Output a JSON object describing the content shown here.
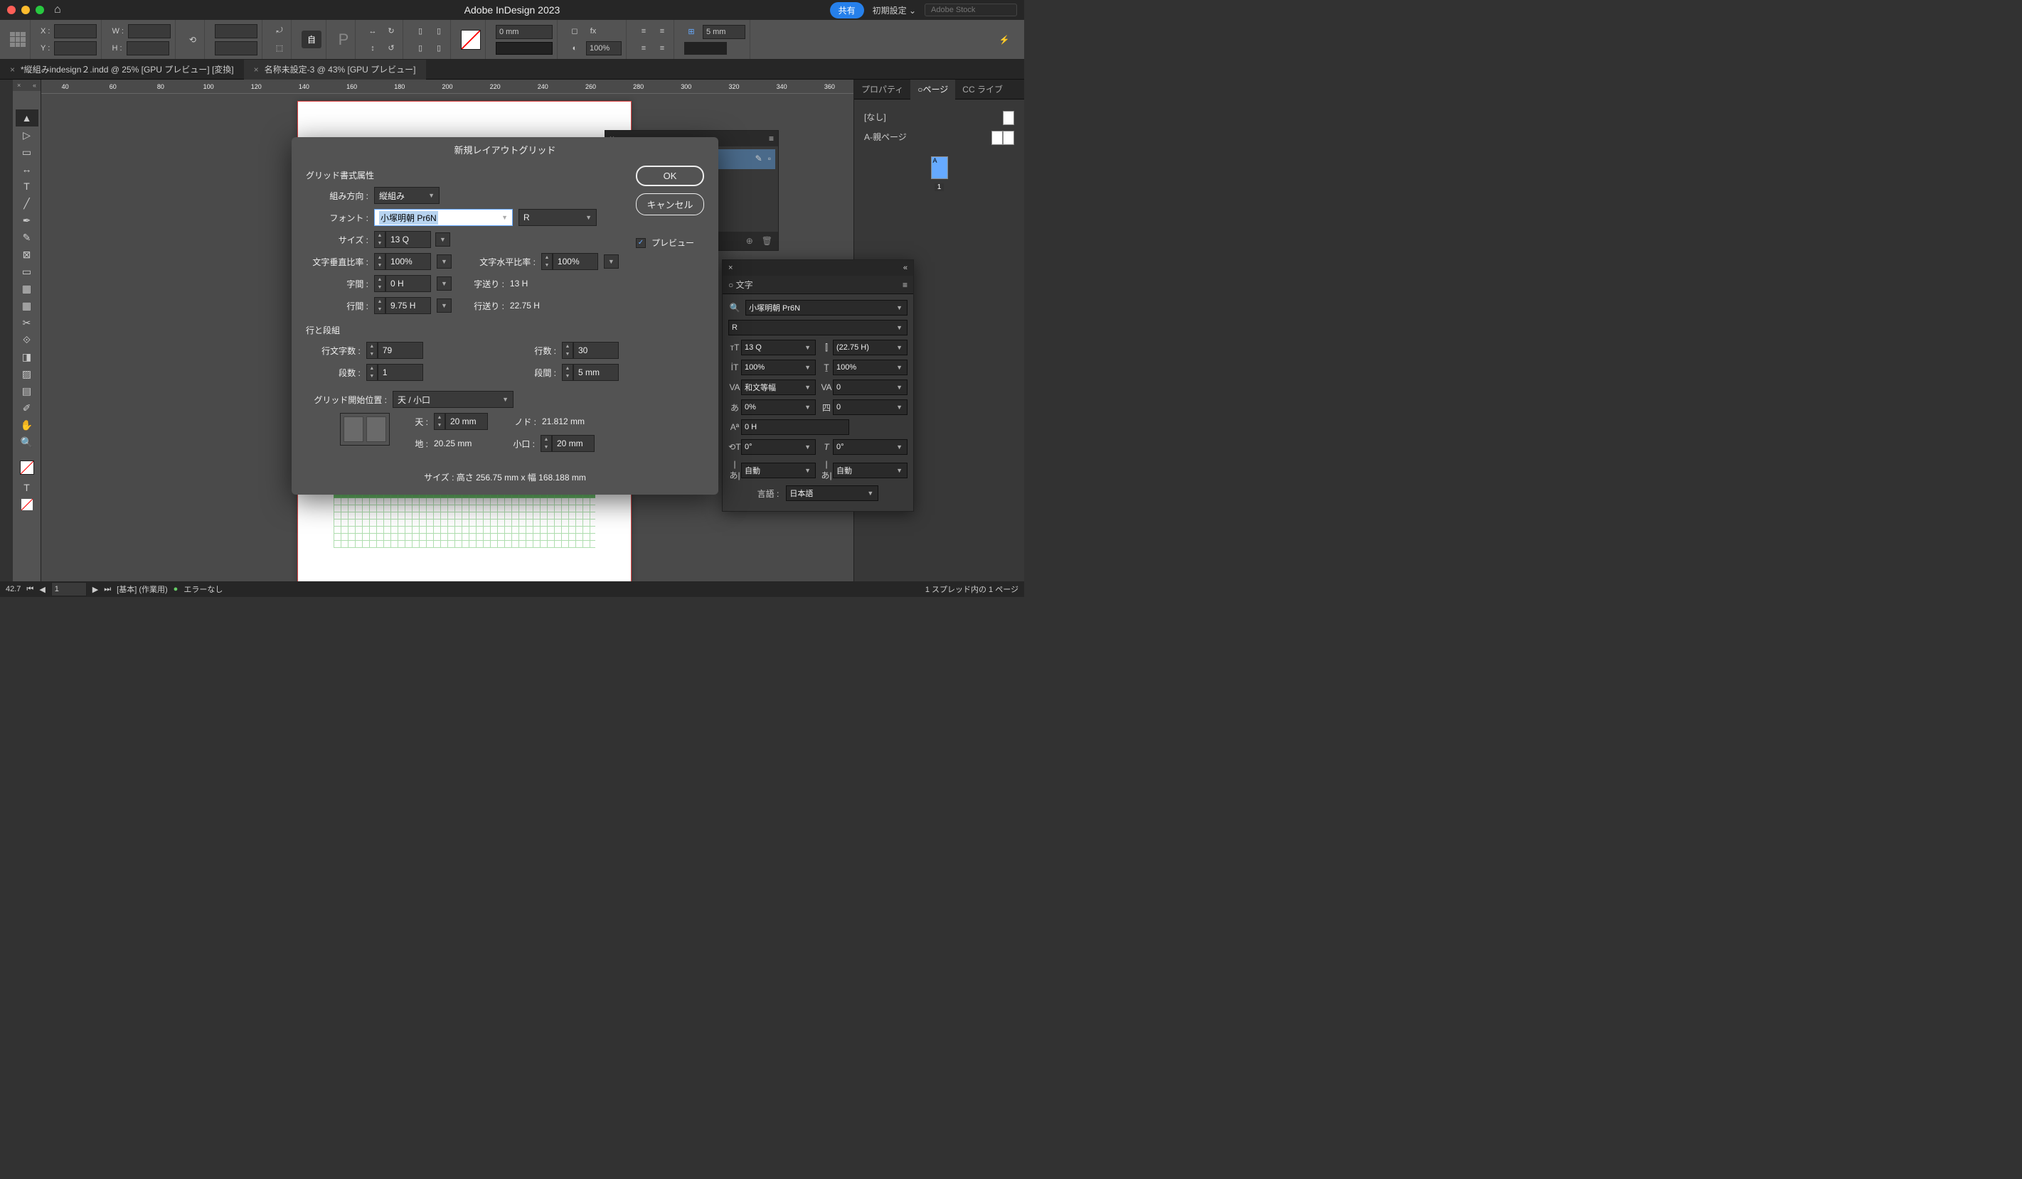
{
  "app": {
    "title": "Adobe InDesign 2023",
    "share": "共有",
    "preset": "初期設定",
    "stock_placeholder": "Adobe Stock"
  },
  "tabs": [
    {
      "label": "*縦組みindesign２.indd @ 25% [GPU プレビュー] [変換]"
    },
    {
      "label": "名称未設定-3 @ 43% [GPU プレビュー]"
    }
  ],
  "controlbar": {
    "x": "X :",
    "y": "Y :",
    "w": "W :",
    "h": "H :",
    "stroke": "0 mm",
    "gap": "5 mm",
    "scale": "100%"
  },
  "ruler": [
    "40",
    "60",
    "80",
    "100",
    "120",
    "140",
    "160",
    "180",
    "200",
    "220",
    "240",
    "260",
    "280",
    "300",
    "320",
    "340",
    "360"
  ],
  "dialog": {
    "title": "新規レイアウトグリッド",
    "section1": "グリッド書式属性",
    "dir_label": "組み方向 :",
    "dir": "縦組み",
    "font_label": "フォント :",
    "font": "小塚明朝 Pr6N",
    "weight": "R",
    "size_label": "サイズ :",
    "size": "13 Q",
    "vscale_label": "文字垂直比率 :",
    "vscale": "100%",
    "hscale_label": "文字水平比率 :",
    "hscale": "100%",
    "charsp_label": "字間 :",
    "charsp": "0 H",
    "charfeed_label": "字送り :",
    "charfeed": "13 H",
    "linesp_label": "行間 :",
    "linesp": "9.75 H",
    "linefeed_label": "行送り :",
    "linefeed": "22.75 H",
    "section2": "行と段組",
    "chars_label": "行文字数 :",
    "chars": "79",
    "lines_label": "行数 :",
    "lines": "30",
    "cols_label": "段数 :",
    "cols": "1",
    "gutter_label": "段間 :",
    "gutter": "5 mm",
    "start_label": "グリッド開始位置 :",
    "start": "天 / 小口",
    "top_label": "天 :",
    "top": "20 mm",
    "nod_label": "ノド :",
    "nod": "21.812 mm",
    "bottom_label": "地 :",
    "bottom": "20.25 mm",
    "outer_label": "小口 :",
    "outer": "20 mm",
    "size_summary": "サイズ : 高さ 256.75 mm x 幅 168.188 mm",
    "ok": "OK",
    "cancel": "キャンセル",
    "preview": "プレビュー"
  },
  "char_panel": {
    "title": "文字",
    "font": "小塚明朝 Pr6N",
    "weight": "R",
    "size": "13 Q",
    "leading": "(22.75 H)",
    "vscale": "100%",
    "hscale": "100%",
    "tracking": "和文等幅",
    "kerning": "0",
    "tsume": "0%",
    "aki": "0",
    "baseline": "0 H",
    "rotation": "0°",
    "skew": "0°",
    "auto1": "自動",
    "auto2": "自動",
    "lang_label": "言語 :",
    "lang": "日本語"
  },
  "pages_panel": {
    "tabs": [
      "プロパティ",
      "ページ",
      "CC ライブ"
    ],
    "none": "[なし]",
    "parent": "A-親ページ",
    "thumb_label": "A",
    "page_num": "1",
    "footer": "1 スプレッド内の 1 ページ"
  },
  "status": {
    "pct": "42.7",
    "page": "1",
    "style": "[基本] (作業用)",
    "errors": "エラーなし"
  }
}
